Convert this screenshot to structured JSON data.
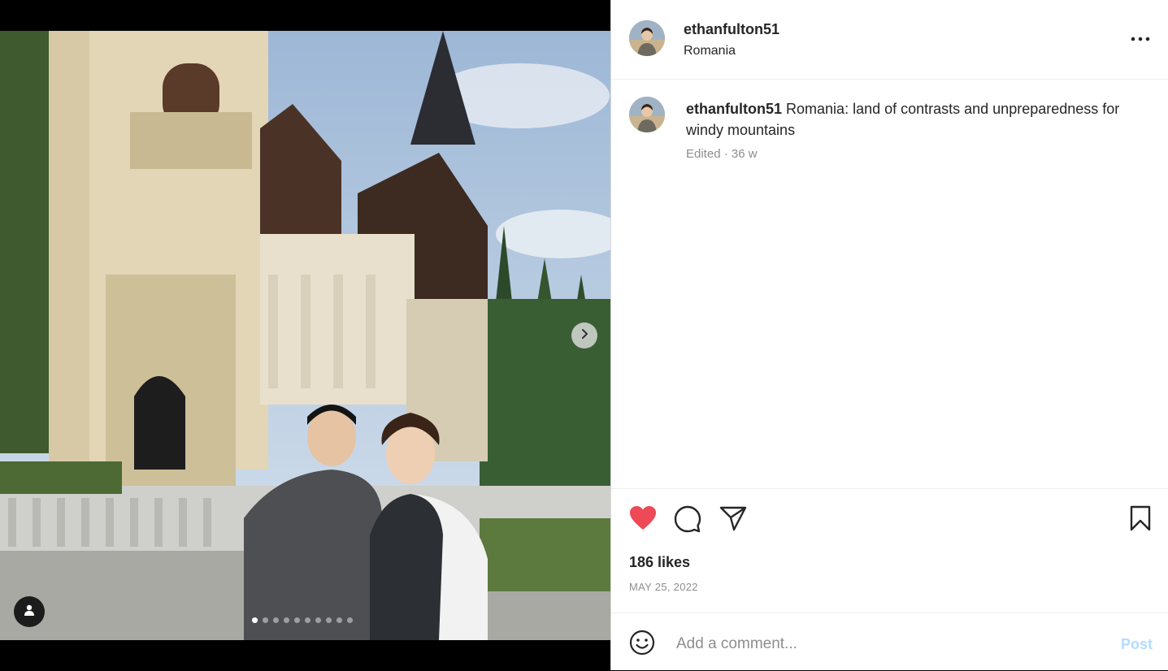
{
  "post": {
    "username": "ethanfulton51",
    "location": "Romania",
    "caption_text": "Romania: land of contrasts and unpreparedness for windy mountains",
    "edited_label": "Edited",
    "age": "36 w",
    "likes": "186 likes",
    "date": "MAY 25, 2022",
    "liked": true
  },
  "carousel": {
    "total_images": 10,
    "active_index": 0
  },
  "comment": {
    "placeholder": "Add a comment...",
    "post_label": "Post"
  },
  "colors": {
    "like_red": "#ed4956",
    "post_button": "#b3dbff",
    "text_primary": "#262626",
    "text_secondary": "#8e8e8e"
  },
  "icons": {
    "more": "more-horizontal-icon",
    "like": "heart-icon",
    "comment": "comment-icon",
    "share": "paper-plane-icon",
    "save": "bookmark-icon",
    "emoji": "emoji-smile-icon",
    "next": "chevron-right-icon",
    "user_tags": "user-icon"
  }
}
